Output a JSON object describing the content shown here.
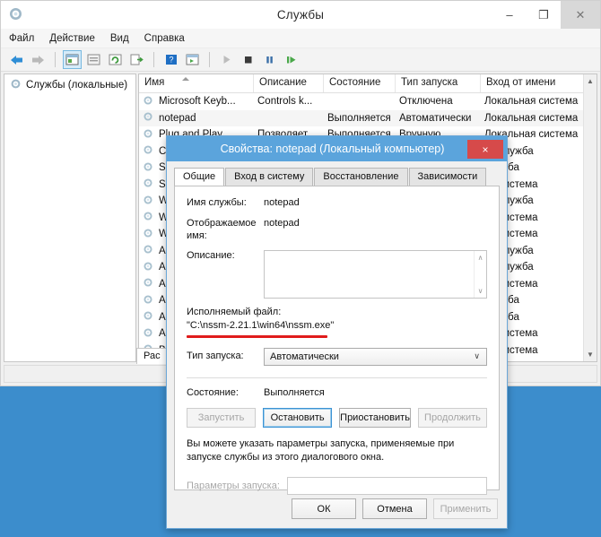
{
  "colors": {
    "desktop": "#3C8DCC",
    "dialog_titlebar": "#5BA4DC",
    "close_red": "#D64A4A",
    "underline_red": "#E01B1B",
    "focus_blue": "#3C93D4"
  },
  "services_window": {
    "title": "Службы",
    "icon_name": "services-gear-icon",
    "window_buttons": {
      "minimize": "–",
      "maximize": "❐",
      "close": "✕"
    },
    "menu": [
      "Файл",
      "Действие",
      "Вид",
      "Справка"
    ],
    "toolbar_icons": [
      "back-arrow-icon",
      "forward-arrow-icon",
      "show-hide-tree-icon",
      "properties-icon",
      "refresh-icon",
      "export-list-icon",
      "help-icon",
      "show-console-icon",
      "start-service-icon",
      "stop-service-icon",
      "pause-service-icon",
      "restart-service-icon"
    ],
    "tree": {
      "root_label": "Службы (локальные)",
      "icon_name": "services-gear-icon"
    },
    "list": {
      "columns": [
        "Имя",
        "Описание",
        "Состояние",
        "Тип запуска",
        "Вход от имени"
      ],
      "sorted_column": "Имя",
      "rows": [
        {
          "name": "Microsoft Keyb...",
          "description": "Controls k...",
          "state": "",
          "startup": "Отключена",
          "logon": "Локальная система"
        },
        {
          "name": "notepad",
          "description": "",
          "state": "Выполняется",
          "startup": "Автоматически",
          "logon": "Локальная система"
        },
        {
          "name": "Plug and Play",
          "description": "Позволяет...",
          "state": "Выполняется",
          "startup": "Вручную",
          "logon": "Локальная система"
        },
        {
          "name": "C",
          "description": "",
          "state": "",
          "startup": "",
          "logon": "ая служба"
        },
        {
          "name": "S",
          "description": "",
          "state": "",
          "startup": "",
          "logon": "служба"
        },
        {
          "name": "S",
          "description": "",
          "state": "",
          "startup": "",
          "logon": "ая система"
        },
        {
          "name": "W",
          "description": "",
          "state": "",
          "startup": "",
          "logon": "ая служба"
        },
        {
          "name": "W",
          "description": "",
          "state": "",
          "startup": "",
          "logon": "ая система"
        },
        {
          "name": "W",
          "description": "",
          "state": "",
          "startup": "",
          "logon": "ая система"
        },
        {
          "name": "A",
          "description": "",
          "state": "",
          "startup": "",
          "logon": "ая служба"
        },
        {
          "name": "A",
          "description": "",
          "state": "",
          "startup": "",
          "logon": "ая служба"
        },
        {
          "name": "A",
          "description": "",
          "state": "",
          "startup": "",
          "logon": "ая система"
        },
        {
          "name": "A",
          "description": "",
          "state": "",
          "startup": "",
          "logon": "служба"
        },
        {
          "name": "A",
          "description": "",
          "state": "",
          "startup": "",
          "logon": "служба"
        },
        {
          "name": "A",
          "description": "",
          "state": "",
          "startup": "",
          "logon": "ая система"
        },
        {
          "name": "B",
          "description": "",
          "state": "",
          "startup": "",
          "logon": "ая система"
        }
      ],
      "scrollbar": {
        "up": "▲",
        "down": "▼"
      }
    },
    "bottom_tab": "Рас"
  },
  "properties_dialog": {
    "title": "Свойства: notepad (Локальный компьютер)",
    "close_label": "×",
    "tabs": [
      {
        "label": "Общие",
        "active": true
      },
      {
        "label": "Вход в систему",
        "active": false
      },
      {
        "label": "Восстановление",
        "active": false
      },
      {
        "label": "Зависимости",
        "active": false
      }
    ],
    "fields": {
      "service_name_label": "Имя службы:",
      "service_name_value": "notepad",
      "display_name_label": "Отображаемое имя:",
      "display_name_value": "notepad",
      "description_label": "Описание:",
      "description_value": "",
      "executable_label": "Исполняемый файл:",
      "executable_value": "\"C:\\nssm-2.21.1\\win64\\nssm.exe\"",
      "startup_type_label": "Тип запуска:",
      "startup_type_value": "Автоматически",
      "status_label": "Состояние:",
      "status_value": "Выполняется"
    },
    "control_buttons": [
      {
        "label": "Запустить",
        "disabled": true,
        "focused": false
      },
      {
        "label": "Остановить",
        "disabled": false,
        "focused": true
      },
      {
        "label": "Приостановить",
        "disabled": false,
        "focused": false
      },
      {
        "label": "Продолжить",
        "disabled": true,
        "focused": false
      }
    ],
    "hint_text": "Вы можете указать параметры запуска, применяемые при запуске службы из этого диалогового окна.",
    "start_params_label": "Параметры запуска:",
    "start_params_value": "",
    "footer_buttons": [
      {
        "label": "ОК",
        "disabled": false
      },
      {
        "label": "Отмена",
        "disabled": false
      },
      {
        "label": "Применить",
        "disabled": true
      }
    ],
    "scroll_arrows": {
      "up": "∧",
      "down": "∨"
    },
    "select_arrow": "∨"
  }
}
